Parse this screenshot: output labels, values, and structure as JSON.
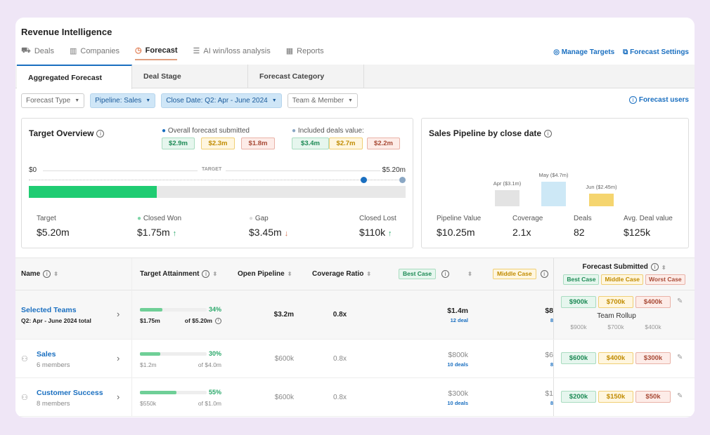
{
  "app": {
    "title": "Revenue Intelligence"
  },
  "nav": {
    "items": [
      {
        "label": "Deals",
        "icon": "deals-icon"
      },
      {
        "label": "Companies",
        "icon": "companies-icon"
      },
      {
        "label": "Forecast",
        "icon": "forecast-icon",
        "active": true
      },
      {
        "label": "AI win/loss analysis",
        "icon": "ai-icon"
      },
      {
        "label": "Reports",
        "icon": "reports-icon"
      }
    ],
    "manage_targets": "Manage Targets",
    "forecast_settings": "Forecast Settings"
  },
  "subtabs": [
    "Aggregated Forecast",
    "Deal Stage",
    "Forecast Category"
  ],
  "filters": {
    "items": [
      "Forecast Type",
      "Pipeline: Sales",
      "Close Date: Q2: Apr - June 2024",
      "Team & Member"
    ],
    "forecast_users": "Forecast users"
  },
  "target_overview": {
    "title": "Target Overview",
    "legend_submitted": "Overall forecast submitted",
    "legend_included": "Included deals value:",
    "submitted": [
      "$2.9m",
      "$2.3m",
      "$1.8m"
    ],
    "included": [
      "$3.4m",
      "$2.7m",
      "$2.2m"
    ],
    "axis_start": "$0",
    "axis_label": "TARGET",
    "axis_end": "$5.20m",
    "progress_percent": 34,
    "colors": {
      "closed_won": "#1fcc72",
      "gap": "#e8e8e8"
    },
    "stats": [
      {
        "label": "Target",
        "value": "$5.20m"
      },
      {
        "label": "Closed Won",
        "value": "$1.75m",
        "trend": "↑"
      },
      {
        "label": "Gap",
        "value": "$3.45m",
        "trend": "↓"
      },
      {
        "label": "Closed Lost",
        "value": "$110k",
        "trend": "↑"
      }
    ]
  },
  "pipeline": {
    "title": "Sales Pipeline by close date",
    "chart_data": {
      "type": "bar",
      "categories": [
        "Apr",
        "May",
        "Jun"
      ],
      "values": [
        3.1,
        4.7,
        2.45
      ],
      "labels": [
        "Apr ($3.1m)",
        "May ($4.7m)",
        "Jun ($2.45m)"
      ],
      "colors": [
        "#e3e3e3",
        "#cde8f6",
        "#f5d56f"
      ]
    },
    "stats": [
      {
        "label": "Pipeline Value",
        "value": "$10.25m"
      },
      {
        "label": "Coverage",
        "value": "2.1x"
      },
      {
        "label": "Deals",
        "value": "82"
      },
      {
        "label": "Avg. Deal value",
        "value": "$125k"
      }
    ]
  },
  "table": {
    "headers": {
      "name": "Name",
      "target": "Target Attainment",
      "open": "Open Pipeline",
      "coverage": "Coverage Ratio",
      "best": "Best Case",
      "middle": "Middle Case",
      "submitted": "Forecast Submitted",
      "sub_best": "Best Case",
      "sub_middle": "Middle Case",
      "sub_worst": "Worst Case"
    },
    "rows": [
      {
        "name": "Selected Teams",
        "sub": "Q2: Apr - June 2024 total",
        "pct": "34%",
        "pct_value": 34,
        "done": "$1.75m",
        "of": "of $5.20m",
        "open": "$3.2m",
        "coverage": "0.8x",
        "best": "$1.4m",
        "best_deals": "12 deal",
        "middle": "$8",
        "middle_deals": "8",
        "fs": [
          "$900k",
          "$700k",
          "$400k"
        ],
        "rollup_label": "Team Rollup",
        "rollup": [
          "$900k",
          "$700k",
          "$400k"
        ]
      },
      {
        "name": "Sales",
        "sub": "6 members",
        "pct": "30%",
        "pct_value": 30,
        "done": "$1.2m",
        "of": "of $4.0m",
        "open": "$600k",
        "coverage": "0.8x",
        "best": "$800k",
        "best_deals": "10 deals",
        "middle": "$6",
        "middle_deals": "8",
        "fs": [
          "$600k",
          "$400k",
          "$300k"
        ]
      },
      {
        "name": "Customer Success",
        "sub": "8 members",
        "pct": "55%",
        "pct_value": 55,
        "done": "$550k",
        "of": "of $1.0m",
        "open": "$600k",
        "coverage": "0.8x",
        "best": "$300k",
        "best_deals": "10 deals",
        "middle": "$1",
        "middle_deals": "8",
        "fs": [
          "$200k",
          "$150k",
          "$50k"
        ]
      }
    ]
  }
}
